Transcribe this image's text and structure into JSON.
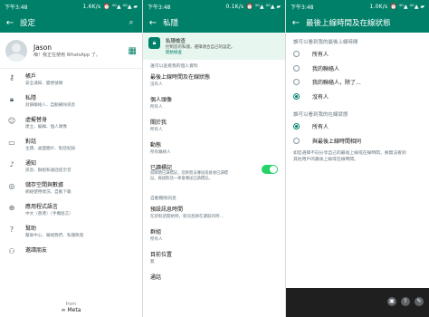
{
  "status": {
    "time": "下午3:48",
    "speed_1": "1.6K/s",
    "speed_2": "0.1K/s",
    "speed_3": "1.0K/s",
    "signal": "⏰ ⁴ᴳ▲ ⁴ᴳ▲ ▰"
  },
  "settings": {
    "title": "設定",
    "profile": {
      "name": "Jason",
      "status": "嗨！我正在使用 WhatsApp 了。"
    },
    "items": [
      {
        "title": "帳戶",
        "sub": "安全通知、變更號碼",
        "icon": "key-icon"
      },
      {
        "title": "私隱",
        "sub": "封鎖聯絡人、自動刪除訊息",
        "icon": "lock-icon"
      },
      {
        "title": "虛擬替身",
        "sub": "建立、編輯、個人頭像",
        "icon": "avatar-icon"
      },
      {
        "title": "對話",
        "sub": "主題、桌面圖片、對話紀錄",
        "icon": "chat-icon"
      },
      {
        "title": "通知",
        "sub": "訊息、群組和通話提示音",
        "icon": "bell-icon"
      },
      {
        "title": "儲存空間與數據",
        "sub": "網絡使用情況、自動下載",
        "icon": "storage-icon"
      },
      {
        "title": "應用程式語言",
        "sub": "中文（香港）（手機語言）",
        "icon": "globe-icon"
      },
      {
        "title": "幫助",
        "sub": "幫助中心、聯絡我們、私隱政策",
        "icon": "help-icon"
      },
      {
        "title": "邀請朋友",
        "sub": "",
        "icon": "people-icon"
      }
    ],
    "from": "from",
    "brand": "∞ Meta"
  },
  "privacy": {
    "title": "私隱",
    "banner": {
      "title": "私隱檢查",
      "sub": "控制您的私隱，選擇適合自己的設定。",
      "link": "開始檢查"
    },
    "section1": "誰可以查看我的個人資料",
    "rows": [
      {
        "title": "最後上線時間及在線狀態",
        "sub": "沒有人"
      },
      {
        "title": "個人頭像",
        "sub": "所有人"
      },
      {
        "title": "關於我",
        "sub": "所有人"
      },
      {
        "title": "動態",
        "sub": "所有聯絡人"
      }
    ],
    "receipts": {
      "title": "已讀標記",
      "sub": [
        "如關閉已讀標記，您將無法傳送或接收已讀標",
        "記。群組對話一律會傳送已讀標記。"
      ],
      "on": true
    },
    "section2": "自動刪除訊息",
    "rows2": [
      {
        "title": "預設訊息時間",
        "sub": "在新對話開始時，新訊息將在選取的時..."
      },
      {
        "title": "群組",
        "sub": "所有人"
      },
      {
        "title": "目前位置",
        "sub": "無"
      },
      {
        "title": "通話",
        "sub": ""
      }
    ]
  },
  "lastseen": {
    "title": "最後上線時間及在線狀態",
    "q1": "誰可以看到我的最後上線時間",
    "options1": [
      "所有人",
      "我的聯絡人",
      "我的聯絡人，除了...",
      "沒有人"
    ],
    "selected1": 3,
    "q2": "誰可以看到我的在線狀態",
    "options2": [
      "所有人",
      "與最後上線時間相同"
    ],
    "selected2": 0,
    "note": [
      "如您選擇不向分享自己的最後上線或在線時間，將無法看到",
      "其他用戶的最後上線或在線時間。"
    ]
  },
  "colors": {
    "brand": "#008069",
    "toggle": "#25d366"
  }
}
